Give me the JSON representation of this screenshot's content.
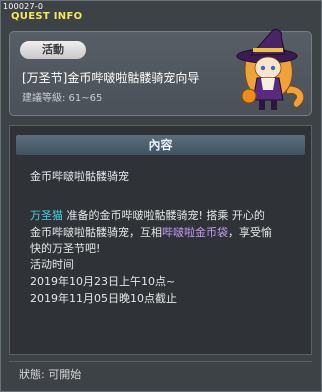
{
  "window": {
    "quest_id": "100027-0",
    "title": "QUEST INFO"
  },
  "summary": {
    "tag": "活動",
    "quest_name": "[万圣节]金币哔啵啦骷髅骑宠向导",
    "level_req": "建議等級: 61~65",
    "npc_icon": "witch-girl-sprite"
  },
  "content": {
    "header": "內容",
    "line1": "金币哔啵啦骷髅骑宠",
    "npc_name": "万圣猫",
    "line2_rest": " 准备的金币哔啵啦骷髅骑宠! 搭乘 开心的",
    "line3_a": "金币哔啵啦骷髅骑宠，互相",
    "item_name": "哔啵啦金币袋",
    "line3_b": "，享受愉",
    "line4": "快的万圣节吧!",
    "period_label": "活动时间",
    "period_start": "2019年10月23日上午10点~",
    "period_end": "2019年11月05日晚10点截止"
  },
  "footer": {
    "status": "狀態:  可開始"
  },
  "colors": {
    "title": "#f4e75a",
    "npc_name": "#49cfe8",
    "item_name": "#c39bf5"
  }
}
